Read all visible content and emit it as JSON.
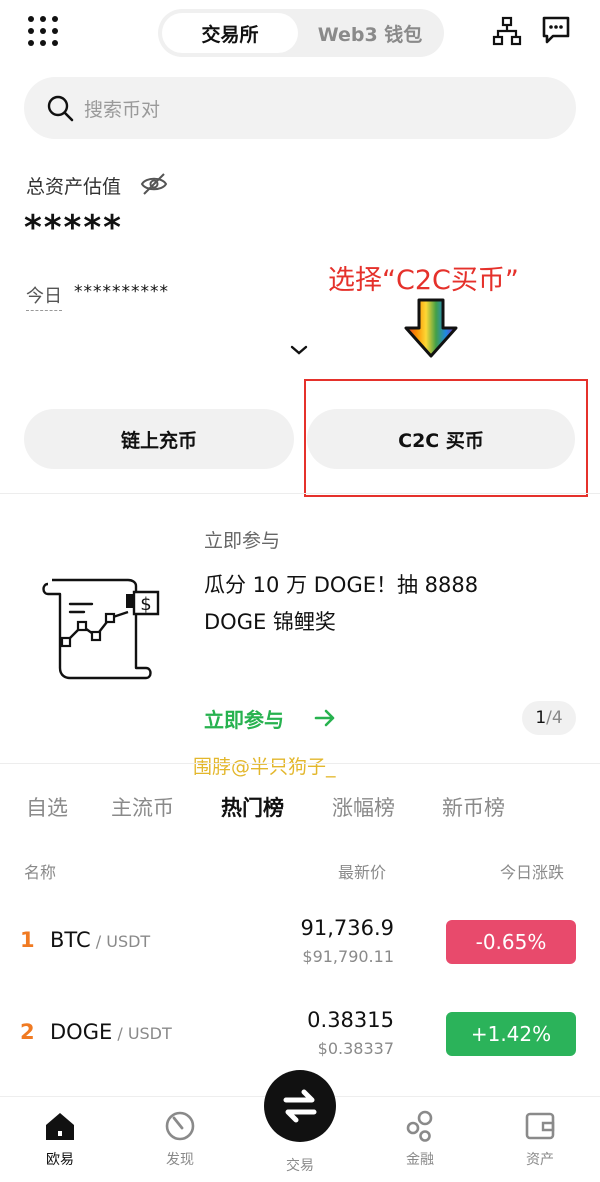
{
  "header": {
    "segments": [
      "交易所",
      "Web3 钱包"
    ],
    "active_segment": "交易所"
  },
  "search": {
    "placeholder": "搜索币对"
  },
  "assets": {
    "label": "总资产估值",
    "value": "*****",
    "today_label": "今日",
    "today_value": "**********"
  },
  "annotation": {
    "text": "选择“C2C买币”"
  },
  "actions": {
    "onchain_deposit": "链上充币",
    "c2c_buy": "C2C 买币"
  },
  "promo": {
    "subtitle": "立即参与",
    "title": "瓜分 10 万 DOGE！抽 8888 DOGE 锦鲤奖",
    "link": "立即参与",
    "page_current": "1",
    "page_total": "/4"
  },
  "watermark": "围脖@半只狗子_",
  "tabs": [
    "自选",
    "主流币",
    "热门榜",
    "涨幅榜",
    "新币榜"
  ],
  "active_tab": "热门榜",
  "columns": {
    "name": "名称",
    "price": "最新价",
    "change": "今日涨跌"
  },
  "rows": [
    {
      "rank": "1",
      "base": "BTC",
      "quote": " / USDT",
      "price": "91,736.9",
      "price_usd": "$91,790.11",
      "change": "-0.65%",
      "color": "#e84a6c"
    },
    {
      "rank": "2",
      "base": "DOGE",
      "quote": " / USDT",
      "price": "0.38315",
      "price_usd": "$0.38337",
      "change": "+1.42%",
      "color": "#2bb35a"
    }
  ],
  "nav": [
    {
      "label": "欧易",
      "icon": "home-icon",
      "active": true
    },
    {
      "label": "发现",
      "icon": "discover-icon",
      "active": false
    },
    {
      "label": "交易",
      "icon": "trade-icon",
      "active": false
    },
    {
      "label": "金融",
      "icon": "finance-icon",
      "active": false
    },
    {
      "label": "资产",
      "icon": "wallet-icon",
      "active": false
    }
  ],
  "colors": {
    "accent_green": "#27b24f",
    "red": "#e5312b",
    "orange_rank": "#f07a22"
  }
}
